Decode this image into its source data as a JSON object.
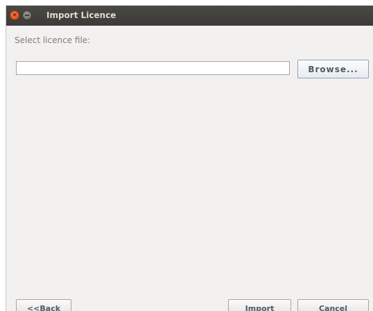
{
  "window": {
    "title": "Import Licence",
    "close_glyph": "×"
  },
  "form": {
    "prompt": "Select licence file:",
    "file_value": "",
    "browse_label": "Browse..."
  },
  "footer": {
    "back_label": "<<Back",
    "import_label": "Import",
    "cancel_label": "Cancel"
  },
  "icons": {
    "close": "close-icon",
    "minimize": "minimize-icon"
  },
  "colors": {
    "close_button": "#e2541a",
    "titlebar": "#3c3b37",
    "dialog_background": "#f2f1f0"
  }
}
